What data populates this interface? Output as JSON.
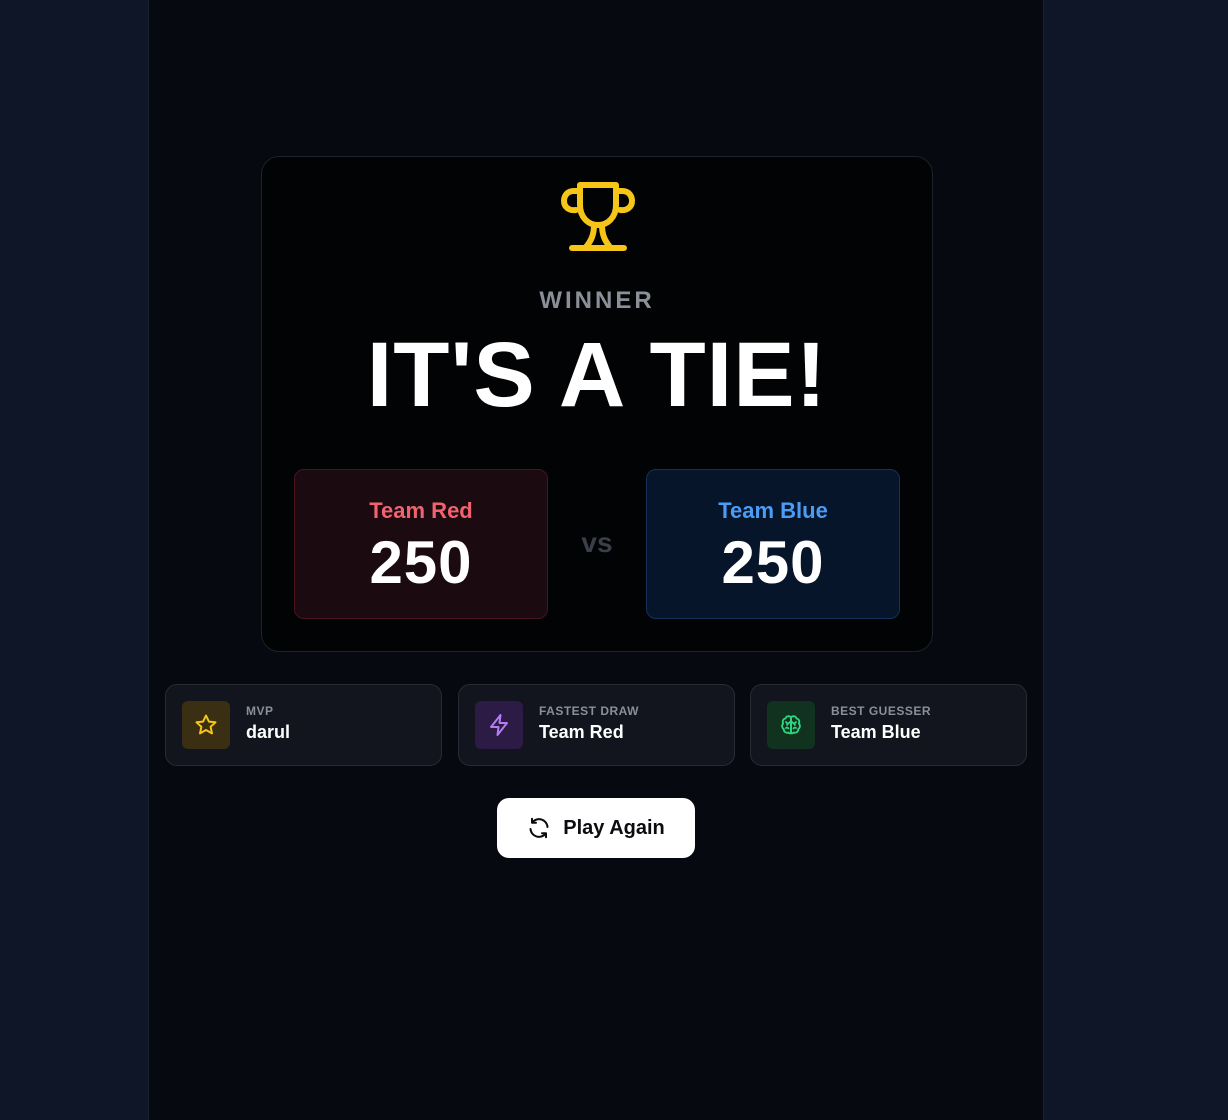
{
  "result": {
    "label": "WINNER",
    "title": "IT'S A TIE!",
    "vs_label": "vs",
    "teams": [
      {
        "name": "Team Red",
        "score": "250",
        "color": "#f0636e"
      },
      {
        "name": "Team Blue",
        "score": "250",
        "color": "#4a9cf5"
      }
    ]
  },
  "awards": [
    {
      "label": "MVP",
      "value": "darul",
      "icon": "star-icon",
      "color": "#f5c518"
    },
    {
      "label": "FASTEST DRAW",
      "value": "Team Red",
      "icon": "lightning-icon",
      "color": "#b57cf2"
    },
    {
      "label": "BEST GUESSER",
      "value": "Team Blue",
      "icon": "brain-icon",
      "color": "#2fd57f"
    }
  ],
  "actions": {
    "play_again": "Play Again"
  },
  "colors": {
    "trophy": "#f5c518",
    "background": "#06090f"
  }
}
